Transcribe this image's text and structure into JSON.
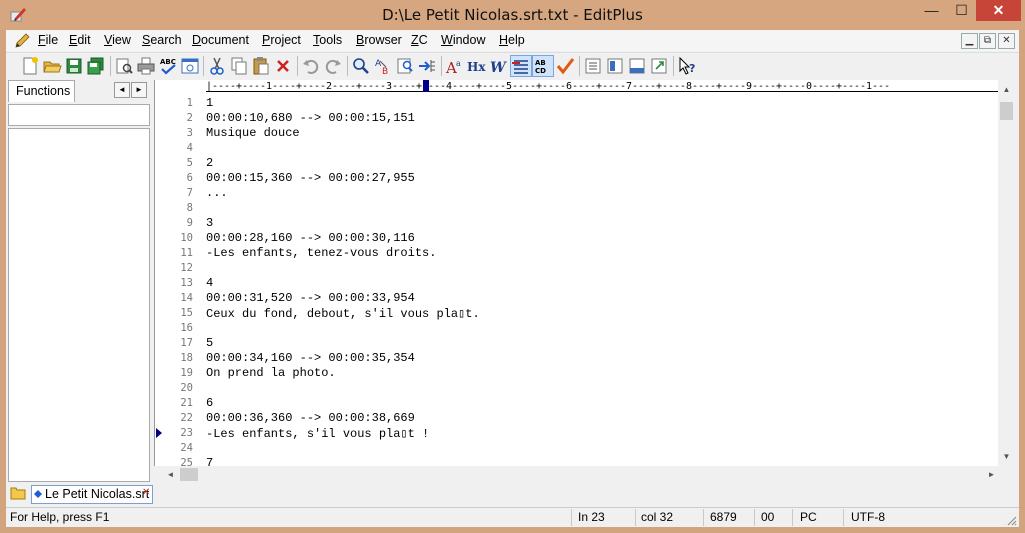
{
  "window": {
    "title": "D:\\Le Petit Nicolas.srt.txt - EditPlus",
    "minimize_label": "—",
    "maximize_label": "☐",
    "close_label": "✕"
  },
  "menu": [
    {
      "pre": "",
      "key": "F",
      "post": "ile"
    },
    {
      "pre": "",
      "key": "E",
      "post": "dit"
    },
    {
      "pre": "",
      "key": "V",
      "post": "iew"
    },
    {
      "pre": "",
      "key": "S",
      "post": "earch"
    },
    {
      "pre": "",
      "key": "D",
      "post": "ocument"
    },
    {
      "pre": "",
      "key": "P",
      "post": "roject"
    },
    {
      "pre": "",
      "key": "T",
      "post": "ools"
    },
    {
      "pre": "",
      "key": "B",
      "post": "rowser"
    },
    {
      "pre": "",
      "key": "Z",
      "post": "C"
    },
    {
      "pre": "",
      "key": "W",
      "post": "indow"
    },
    {
      "pre": "",
      "key": "H",
      "post": "elp"
    }
  ],
  "side_panel": {
    "tab_label": "Functions",
    "prev_arrow": "◄",
    "next_arrow": "►"
  },
  "ruler": "|----+----1----+----2----+----3----+----4----+----5----+----6----+----7----+----8----+----9----+----0----+----1---",
  "editor": {
    "lines": [
      {
        "n": "1",
        "text": "1"
      },
      {
        "n": "2",
        "text": "00:00:10,680 --> 00:00:15,151"
      },
      {
        "n": "3",
        "text": "Musique douce"
      },
      {
        "n": "4",
        "text": ""
      },
      {
        "n": "5",
        "text": "2"
      },
      {
        "n": "6",
        "text": "00:00:15,360 --> 00:00:27,955"
      },
      {
        "n": "7",
        "text": "..."
      },
      {
        "n": "8",
        "text": ""
      },
      {
        "n": "9",
        "text": "3"
      },
      {
        "n": "10",
        "text": "00:00:28,160 --> 00:00:30,116"
      },
      {
        "n": "11",
        "text": "-Les enfants, tenez-vous droits."
      },
      {
        "n": "12",
        "text": ""
      },
      {
        "n": "13",
        "text": "4"
      },
      {
        "n": "14",
        "text": "00:00:31,520 --> 00:00:33,954"
      },
      {
        "n": "15",
        "text": "Ceux du fond, debout, s'il vous pla▯t."
      },
      {
        "n": "16",
        "text": ""
      },
      {
        "n": "17",
        "text": "5"
      },
      {
        "n": "18",
        "text": "00:00:34,160 --> 00:00:35,354"
      },
      {
        "n": "19",
        "text": "On prend la photo."
      },
      {
        "n": "20",
        "text": ""
      },
      {
        "n": "21",
        "text": "6"
      },
      {
        "n": "22",
        "text": "00:00:36,360 --> 00:00:38,669"
      },
      {
        "n": "23",
        "text": "-Les enfants, s'il vous pla▯t !"
      },
      {
        "n": "24",
        "text": ""
      },
      {
        "n": "25",
        "text": "7"
      }
    ]
  },
  "scroll": {
    "up": "▲",
    "down": "▼",
    "left": "◄",
    "right": "►"
  },
  "doc_tab": {
    "label": "Le Petit Nicolas.srt",
    "close": "✕"
  },
  "status": {
    "help": "For Help, press F1",
    "line": "In 23",
    "col": "col 32",
    "size": "6879",
    "code": "00",
    "mode": "PC",
    "encoding": "UTF-8"
  },
  "colors": {
    "title_bg": "#d5a67f",
    "close_bg": "#c74438",
    "accent": "#00008b"
  }
}
